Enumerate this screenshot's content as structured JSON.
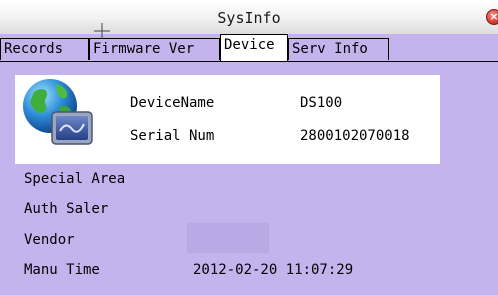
{
  "window": {
    "title": "SysInfo",
    "close_glyph": "×"
  },
  "tabs": [
    {
      "label": "Records",
      "active": false
    },
    {
      "label": "Firmware Ver",
      "active": false
    },
    {
      "label": "Device",
      "active": true
    },
    {
      "label": "Serv Info",
      "active": false
    }
  ],
  "device": {
    "icon": "globe-monitor-icon",
    "name_label": "DeviceName",
    "name_value": "DS100",
    "serial_label": "Serial Num",
    "serial_value": "2800102070018"
  },
  "fields": {
    "special_area_label": "Special Area",
    "auth_saler_label": "Auth Saler",
    "vendor_label": "Vendor",
    "manu_time_label": "Manu Time",
    "manu_time_value": "2012-02-20 11:07:29"
  },
  "colors": {
    "background": "#c5b3ee",
    "close_button": "#d43a2c"
  }
}
